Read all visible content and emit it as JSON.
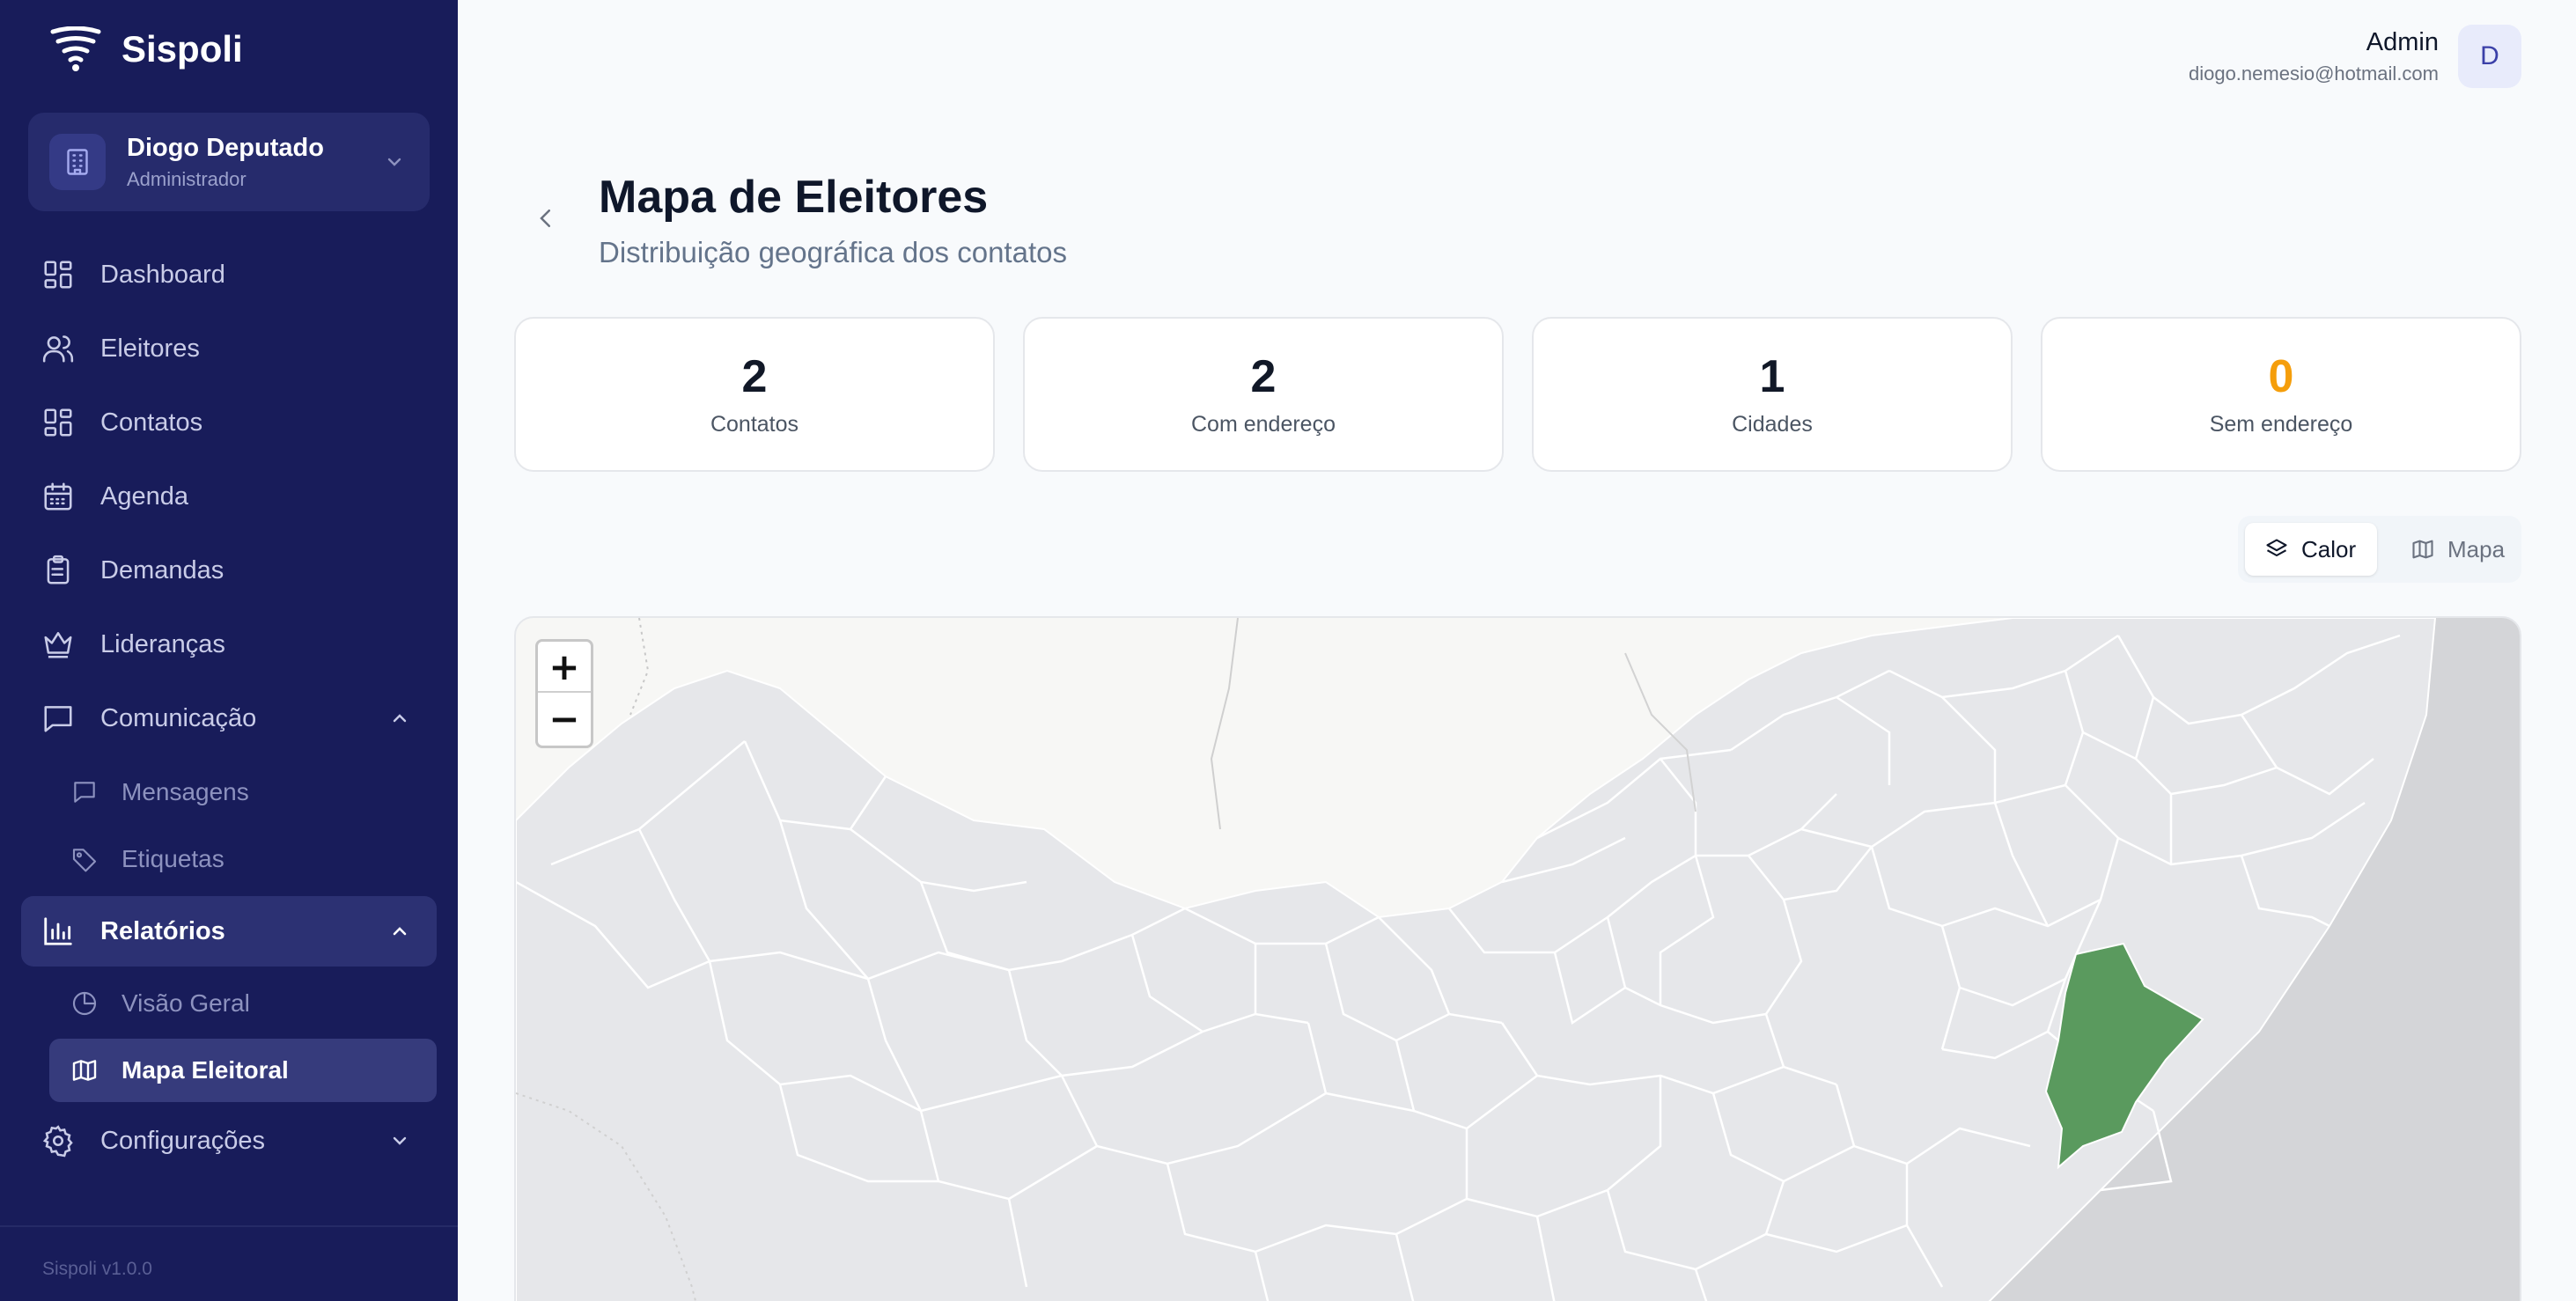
{
  "app": {
    "name": "Sispoli",
    "version": "Sispoli v1.0.0"
  },
  "org": {
    "name": "Diogo Deputado",
    "role": "Administrador"
  },
  "nav": {
    "dashboard": "Dashboard",
    "eleitores": "Eleitores",
    "contatos": "Contatos",
    "agenda": "Agenda",
    "demandas": "Demandas",
    "liderancas": "Lideranças",
    "comunicacao": "Comunicação",
    "mensagens": "Mensagens",
    "etiquetas": "Etiquetas",
    "relatorios": "Relatórios",
    "visao_geral": "Visão Geral",
    "mapa_eleitoral": "Mapa Eleitoral",
    "configuracoes": "Configurações"
  },
  "user": {
    "name": "Admin",
    "email": "diogo.nemesio@hotmail.com",
    "initial": "D"
  },
  "page": {
    "title": "Mapa de Eleitores",
    "subtitle": "Distribuição geográfica dos contatos"
  },
  "stats": [
    {
      "value": "2",
      "label": "Contatos"
    },
    {
      "value": "2",
      "label": "Com endereço"
    },
    {
      "value": "1",
      "label": "Cidades"
    },
    {
      "value": "0",
      "label": "Sem endereço"
    }
  ],
  "view_toggle": {
    "calor": "Calor",
    "mapa": "Mapa",
    "active": "Calor"
  },
  "map": {
    "zoom_in": "+",
    "zoom_out": "−",
    "highlight_color": "#5a9a5e"
  },
  "colors": {
    "sidebar": "#181c5a",
    "accent": "#2c3173",
    "warning": "#f59e0b"
  }
}
